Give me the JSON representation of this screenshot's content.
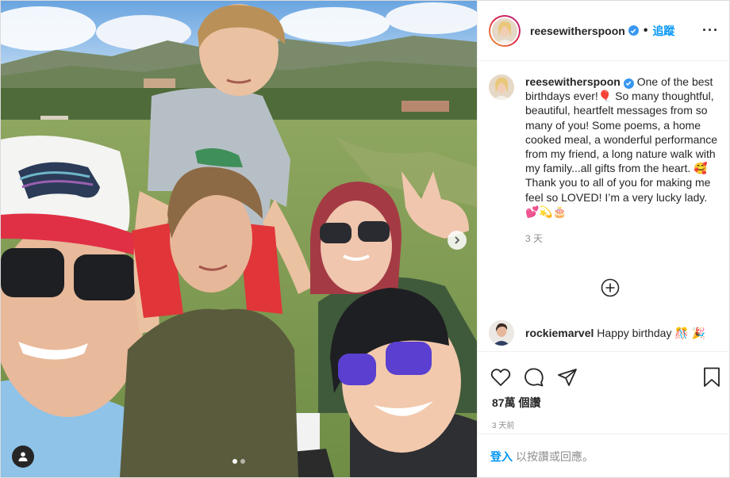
{
  "post": {
    "author": {
      "username": "reesewitherspoon",
      "verified": true,
      "follow_separator": "•",
      "follow_label": "追蹤",
      "more_label": "···"
    },
    "media": {
      "slide_count": 2,
      "active_slide": 1
    },
    "caption": {
      "username": "reesewitherspoon",
      "text": "One of the best birthdays ever!🎈 So many thoughtful, beautiful, heartfelt messages from so many of you! Some poems, a home cooked meal, a wonderful performance from my friend, a long nature walk with my family...all gifts from the heart. 🥰 Thank you to all of you for making me feel so LOVED! I’m a very lucky lady. 💕💫🎂",
      "age": "3 天"
    },
    "comments": [
      {
        "username": "rockiemarvel",
        "text": "Happy birthday 🎊 🎉"
      }
    ],
    "stats": {
      "views": "87萬 個讚",
      "timestamp": "3 天前"
    },
    "login_prompt": {
      "link": "登入",
      "rest": "以按讚或回應。"
    },
    "colors": {
      "link_blue": "#0095f6",
      "verified_blue": "#3897f0",
      "secondary_text": "#8e8e8e"
    }
  }
}
